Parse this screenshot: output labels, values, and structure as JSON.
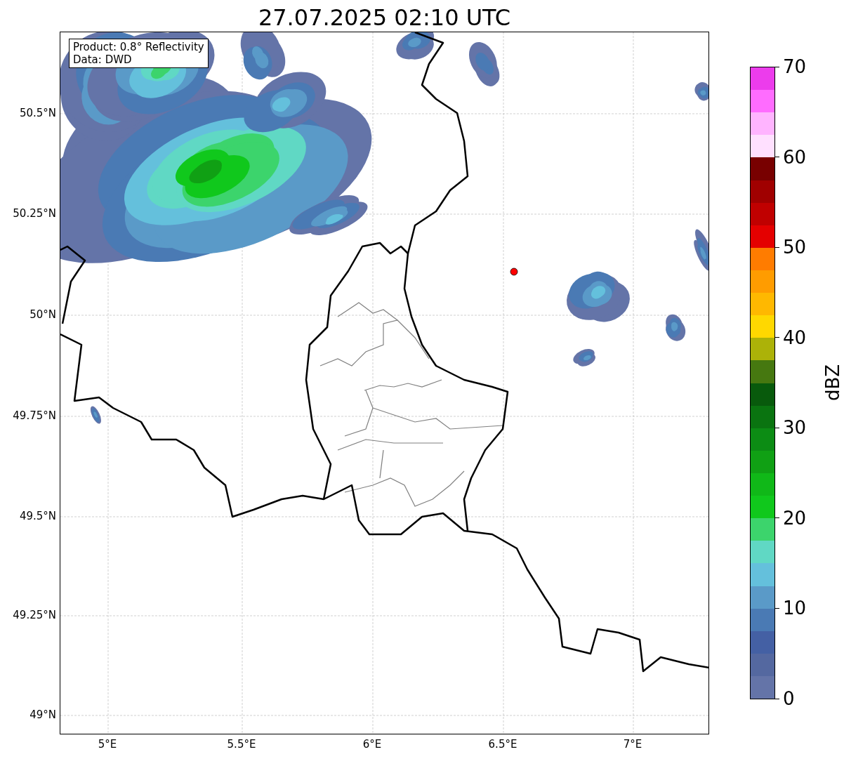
{
  "title": "27.07.2025 02:10 UTC",
  "annotation": [
    "Product: 0.8° Reflectivity",
    "Data: DWD"
  ],
  "lat_ticks": [
    "50.5°N",
    "50.25°N",
    "50°N",
    "49.75°N",
    "49.5°N",
    "49.25°N",
    "49°N"
  ],
  "lon_ticks": [
    "5°E",
    "5.5°E",
    "6°E",
    "6.5°E",
    "7°E"
  ],
  "colorbar": {
    "label": "dBZ",
    "ticks": [
      "70",
      "60",
      "50",
      "40",
      "30",
      "20",
      "10",
      "0"
    ],
    "bands": [
      {
        "color": "#ec3cec"
      },
      {
        "color": "#ff6cff"
      },
      {
        "color": "#ffb4ff"
      },
      {
        "color": "#ffe0ff"
      },
      {
        "color": "#780000"
      },
      {
        "color": "#a00000"
      },
      {
        "color": "#c00000"
      },
      {
        "color": "#e40000"
      },
      {
        "color": "#ff7c00"
      },
      {
        "color": "#ff9c00"
      },
      {
        "color": "#ffb800"
      },
      {
        "color": "#ffd800"
      },
      {
        "color": "#acb208"
      },
      {
        "color": "#467810"
      },
      {
        "color": "#085a0c"
      },
      {
        "color": "#0a7410"
      },
      {
        "color": "#0c8c14"
      },
      {
        "color": "#10a014"
      },
      {
        "color": "#10b818"
      },
      {
        "color": "#10c81c"
      },
      {
        "color": "#3cd46c"
      },
      {
        "color": "#60d8c4"
      },
      {
        "color": "#64c0dc"
      },
      {
        "color": "#5a9ac8"
      },
      {
        "color": "#4a7ab4"
      },
      {
        "color": "#4460a4"
      },
      {
        "color": "#5468a0"
      },
      {
        "color": "#6474a8"
      }
    ]
  }
}
